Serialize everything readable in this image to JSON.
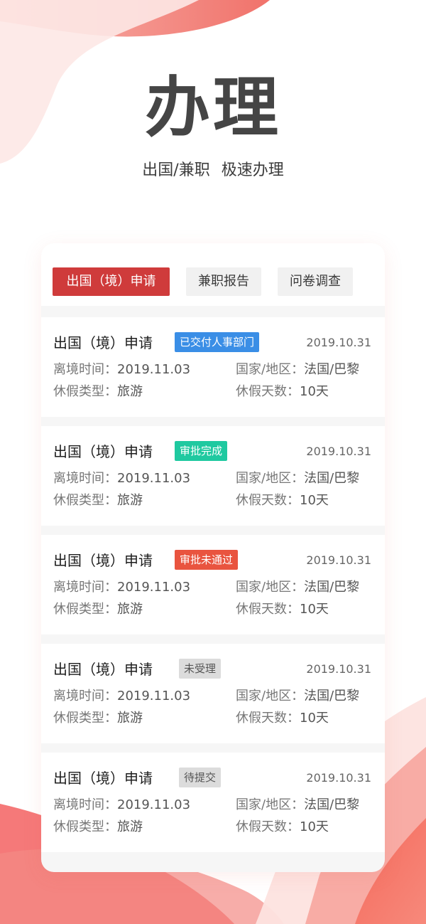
{
  "hero": {
    "title": "办理",
    "subtitle_part1": "出国/兼职",
    "subtitle_part2": "极速办理"
  },
  "colors": {
    "accent_red": "#cf3b3b",
    "badge_blue": "#3a8ee6",
    "badge_green": "#1fc9a0",
    "badge_red": "#e9543f",
    "badge_gray": "#dcdcdc"
  },
  "tabs": [
    {
      "label": "出国（境）申请",
      "active": true
    },
    {
      "label": "兼职报告",
      "active": false
    },
    {
      "label": "问卷调查",
      "active": false
    }
  ],
  "records": [
    {
      "title": "出国（境）申请",
      "status": "已交付人事部门",
      "status_color": "blue",
      "date": "2019.10.31",
      "depart_label": "离境时间：",
      "depart_value": "2019.11.03",
      "country_label": "国家/地区：",
      "country_value": "法国/巴黎",
      "type_label": "休假类型：",
      "type_value": "旅游",
      "days_label": "休假天数：",
      "days_value": "10天"
    },
    {
      "title": "出国（境）申请",
      "status": "审批完成",
      "status_color": "green",
      "date": "2019.10.31",
      "depart_label": "离境时间：",
      "depart_value": "2019.11.03",
      "country_label": "国家/地区：",
      "country_value": "法国/巴黎",
      "type_label": "休假类型：",
      "type_value": "旅游",
      "days_label": "休假天数：",
      "days_value": "10天"
    },
    {
      "title": "出国（境）申请",
      "status": "审批未通过",
      "status_color": "red",
      "date": "2019.10.31",
      "depart_label": "离境时间：",
      "depart_value": "2019.11.03",
      "country_label": "国家/地区：",
      "country_value": "法国/巴黎",
      "type_label": "休假类型：",
      "type_value": "旅游",
      "days_label": "休假天数：",
      "days_value": "10天"
    },
    {
      "title": "出国（境）申请",
      "status": "未受理",
      "status_color": "gray",
      "date": "2019.10.31",
      "depart_label": "离境时间：",
      "depart_value": "2019.11.03",
      "country_label": "国家/地区：",
      "country_value": "法国/巴黎",
      "type_label": "休假类型：",
      "type_value": "旅游",
      "days_label": "休假天数：",
      "days_value": "10天"
    },
    {
      "title": "出国（境）申请",
      "status": "待提交",
      "status_color": "gray",
      "date": "2019.10.31",
      "depart_label": "离境时间：",
      "depart_value": "2019.11.03",
      "country_label": "国家/地区：",
      "country_value": "法国/巴黎",
      "type_label": "休假类型：",
      "type_value": "旅游",
      "days_label": "休假天数：",
      "days_value": "10天"
    }
  ]
}
